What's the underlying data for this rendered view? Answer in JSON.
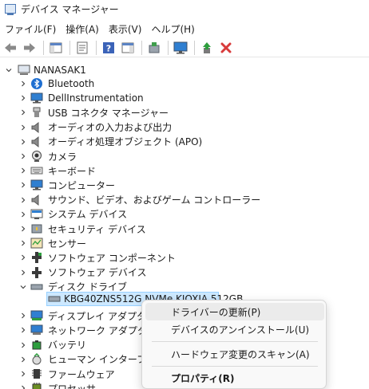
{
  "window": {
    "title": "デバイス マネージャー"
  },
  "menu": [
    "ファイル(F)",
    "操作(A)",
    "表示(V)",
    "ヘルプ(H)"
  ],
  "toolbar": {
    "buttons": [
      "back-arrow-icon",
      "forward-arrow-icon",
      "show-hide-tree-icon",
      "properties-sheet-icon",
      "help-icon",
      "action-pane-icon",
      "scan-hardware-icon",
      "monitor-icon",
      "update-driver-icon",
      "uninstall-x-icon"
    ],
    "accent_delete": "#d83b3b",
    "accent_update": "#2e9e3e"
  },
  "tree": {
    "root": "NANASAK1",
    "categories": [
      {
        "label": "Bluetooth",
        "icon": "bluetooth-icon"
      },
      {
        "label": "DellInstrumentation",
        "icon": "monitor-icon"
      },
      {
        "label": "USB コネクタ マネージャー",
        "icon": "usb-icon"
      },
      {
        "label": "オーディオの入力および出力",
        "icon": "speaker-icon"
      },
      {
        "label": "オーディオ処理オブジェクト (APO)",
        "icon": "speaker-icon"
      },
      {
        "label": "カメラ",
        "icon": "camera-icon"
      },
      {
        "label": "キーボード",
        "icon": "keyboard-icon"
      },
      {
        "label": "コンピューター",
        "icon": "monitor-icon"
      },
      {
        "label": "サウンド、ビデオ、およびゲーム コントローラー",
        "icon": "speaker-icon"
      },
      {
        "label": "システム デバイス",
        "icon": "system-device-icon"
      },
      {
        "label": "セキュリティ デバイス",
        "icon": "security-device-icon"
      },
      {
        "label": "センサー",
        "icon": "sensor-icon"
      },
      {
        "label": "ソフトウェア コンポーネント",
        "icon": "software-component-icon"
      },
      {
        "label": "ソフトウェア デバイス",
        "icon": "software-device-icon"
      },
      {
        "label": "ディスク ドライブ",
        "icon": "disk-drive-icon",
        "expanded": true,
        "child": "KBG40ZNS512G NVMe KIOXIA 512GB"
      },
      {
        "label": "ディスプレイ アダプター",
        "icon": "display-adapter-icon"
      },
      {
        "label": "ネットワーク アダプター",
        "icon": "network-adapter-icon"
      },
      {
        "label": "バッテリ",
        "icon": "battery-icon"
      },
      {
        "label": "ヒューマン インターフェイス",
        "icon": "hid-icon"
      },
      {
        "label": "ファームウェア",
        "icon": "firmware-icon"
      },
      {
        "label": "プロセッサ",
        "icon": "processor-icon"
      }
    ]
  },
  "context_menu": {
    "items": [
      "ドライバーの更新(P)",
      "デバイスのアンインストール(U)",
      "ハードウェア変更のスキャン(A)",
      "プロパティ(R)"
    ]
  }
}
